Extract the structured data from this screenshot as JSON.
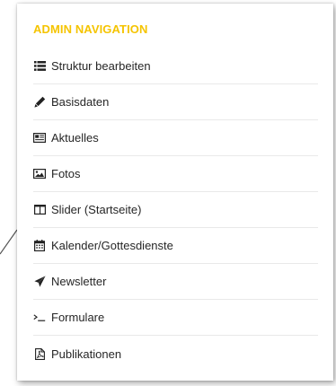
{
  "panel": {
    "heading": "ADMIN NAVIGATION",
    "heading_color": "#f5c400"
  },
  "nav": {
    "items": [
      {
        "label": "Struktur bearbeiten",
        "icon": "list-icon"
      },
      {
        "label": "Basisdaten",
        "icon": "pencil-icon"
      },
      {
        "label": "Aktuelles",
        "icon": "newspaper-icon"
      },
      {
        "label": "Fotos",
        "icon": "image-icon"
      },
      {
        "label": "Slider (Startseite)",
        "icon": "columns-icon"
      },
      {
        "label": "Kalender/Gottesdienste",
        "icon": "calendar-icon"
      },
      {
        "label": "Newsletter",
        "icon": "paper-plane-icon"
      },
      {
        "label": "Formulare",
        "icon": "terminal-icon"
      },
      {
        "label": "Publikationen",
        "icon": "pdf-file-icon"
      }
    ]
  },
  "colors": {
    "text": "#262626",
    "divider": "#e9e9e9",
    "icon": "#222222"
  }
}
